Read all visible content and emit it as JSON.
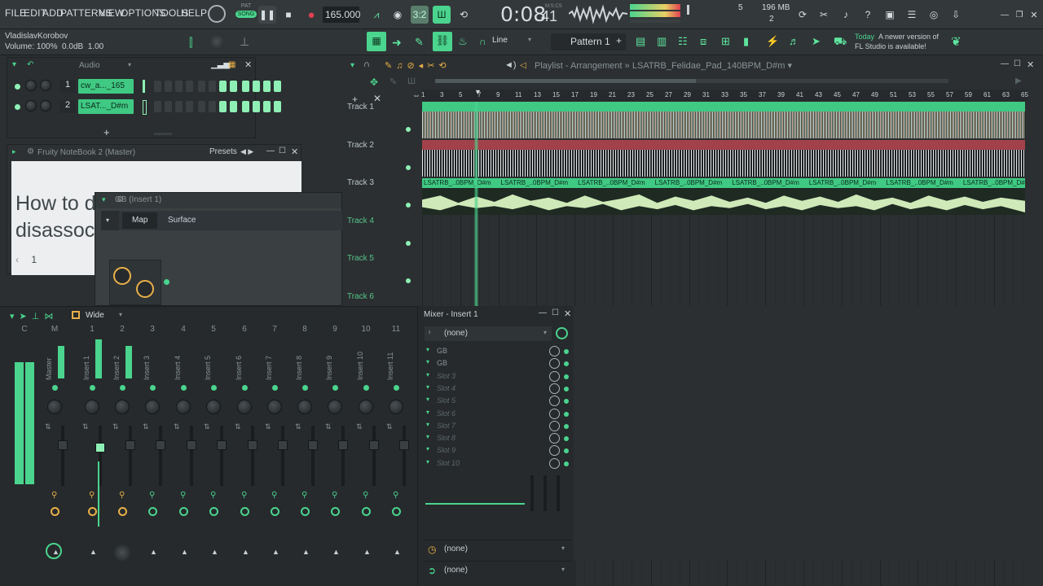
{
  "menu": [
    "FILE",
    "EDIT",
    "ADD",
    "PATTERNS",
    "VIEW",
    "OPTIONS",
    "TOOLS",
    "HELP"
  ],
  "transport": {
    "pat_label": "PAT",
    "song_label": "SONG",
    "tempo": "165.000",
    "time": "0:08",
    "time_small": "41",
    "time_units": "M:S:CS",
    "memory": "196 MB",
    "cpu_a": "5",
    "cpu_b": "2"
  },
  "hint_bar": {
    "user": "VladislavKorobov",
    "status": "Volume: 100%  0.0dB  1.00"
  },
  "toolbar2": {
    "snap": "Line",
    "pattern": "Pattern 1",
    "news_date": "Today",
    "news_text_1": "A newer version of",
    "news_text_2": "FL Studio is available!"
  },
  "rack": {
    "filter": "Audio",
    "channels": [
      {
        "num": "1",
        "name": "cw_a..._165"
      },
      {
        "num": "2",
        "name": "LSAT..._D#m"
      }
    ]
  },
  "notebook": {
    "title": "Fruity NoteBook 2 (Master)",
    "presets": "Presets",
    "line1": "How to d",
    "line2": "disassoci",
    "page": "1"
  },
  "gb": {
    "title": "GB (Insert 1)",
    "tabs": [
      "Map",
      "Surface"
    ]
  },
  "playlist": {
    "title": "Playlist - Arrangement",
    "sep": "»",
    "project": "LSATRB_Felidae_Pad_140BPM_D#m",
    "ruler": [
      "1",
      "3",
      "5",
      "7",
      "9",
      "11",
      "13",
      "15",
      "17",
      "19",
      "21",
      "23",
      "25",
      "27",
      "29",
      "31",
      "33",
      "35",
      "37",
      "39",
      "41",
      "43",
      "45",
      "47",
      "49",
      "51",
      "53",
      "55",
      "57",
      "59",
      "61",
      "63",
      "65"
    ],
    "tracks": [
      "Track 1",
      "Track 2",
      "Track 3",
      "Track 4",
      "Track 5",
      "Track 6"
    ],
    "clip_label": "LSATRB_..0BPM_D#m"
  },
  "mixer": {
    "mode": "Wide",
    "strip_nums": [
      "C",
      "M",
      "1",
      "2",
      "3",
      "4",
      "5",
      "6",
      "7",
      "8",
      "9",
      "10",
      "11"
    ],
    "strip_labels": [
      "Master",
      "Insert 1",
      "Insert 2",
      "Insert 3",
      "Insert 4",
      "Insert 5",
      "Insert 6",
      "Insert 7",
      "Insert 8",
      "Insert 9",
      "Insert 10",
      "Insert 11"
    ]
  },
  "insert": {
    "title": "Mixer - Insert 1",
    "input": "(none)",
    "slots": [
      "GB",
      "GB",
      "Slot 3",
      "Slot 4",
      "Slot 5",
      "Slot 6",
      "Slot 7",
      "Slot 8",
      "Slot 9",
      "Slot 10"
    ],
    "out1": "(none)",
    "out2": "(none)"
  },
  "colors": {
    "accent": "#4ad48e",
    "clip_green": "#3fc983",
    "clip_red": "#a2414a",
    "clip_light": "#cfe9b8"
  }
}
